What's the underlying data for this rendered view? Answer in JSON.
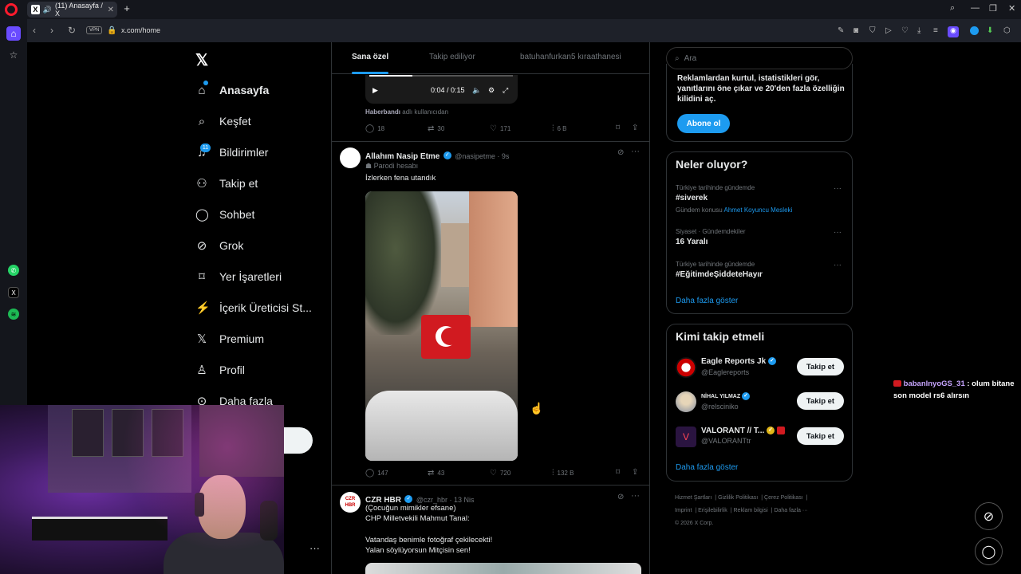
{
  "browser": {
    "tab_title": "(11) Anasayfa / X",
    "url": "x.com/home",
    "vpn_label": "VPN"
  },
  "nav": {
    "items": [
      {
        "label": "Anasayfa",
        "icon": "home-icon"
      },
      {
        "label": "Keşfet",
        "icon": "search-icon"
      },
      {
        "label": "Bildirimler",
        "icon": "bell-icon"
      },
      {
        "label": "Takip et",
        "icon": "add-user-icon"
      },
      {
        "label": "Sohbet",
        "icon": "chat-icon"
      },
      {
        "label": "Grok",
        "icon": "grok-icon"
      },
      {
        "label": "Yer İşaretleri",
        "icon": "bookmark-icon"
      },
      {
        "label": "İçerik Üreticisi St...",
        "icon": "lightning-icon"
      },
      {
        "label": "Premium",
        "icon": "x-logo-icon"
      },
      {
        "label": "Profil",
        "icon": "person-icon"
      },
      {
        "label": "Daha fazla",
        "icon": "more-circle-icon"
      }
    ],
    "notif_count": "11"
  },
  "feed": {
    "tabs": [
      "Sana özel",
      "Takip ediliyor",
      "batuhanfurkan5 kıraathanesi"
    ],
    "video": {
      "time": "0:04 / 0:15",
      "progress": 0.3
    },
    "post0": {
      "source": "Haberbandı",
      "source_suffix": "adlı kullanıcıdan",
      "replies": "18",
      "reposts": "30",
      "likes": "171",
      "views": "6 B"
    },
    "post1": {
      "name": "Allahım Nasip Etme",
      "handle": "@nasipetme · 9s",
      "label": "Parodi hesabı",
      "text": "İzlerken fena utandık",
      "replies": "147",
      "reposts": "43",
      "likes": "720",
      "views": "132 B"
    },
    "post2": {
      "name": "CZR HBR",
      "handle": "@czr_hbr · 13 Nis",
      "avatar_text": "CZR HBR",
      "lines": [
        "(Çocuğun mimikler efsane)",
        "CHP Milletvekili Mahmut Tanal:",
        "",
        "Vatandaş benimle fotoğraf çekilecekti!",
        "Yalan söylüyorsun Mitçisin sen!"
      ]
    }
  },
  "right": {
    "search_placeholder": "Ara",
    "premium_text": "Reklamlardan kurtul, istatistikleri gör, yanıtlarını öne çıkar ve 20'den fazla özelliğin kilidini aç.",
    "subscribe_label": "Abone ol",
    "trends_title": "Neler oluyor?",
    "trends": [
      {
        "category": "Türkiye tarihinde gündemde",
        "name": "#siverek",
        "topic_prefix": "Gündem konusu",
        "topic": "Ahmet Koyuncu Mesleki"
      },
      {
        "category": "Siyaset · Gündemdekiler",
        "name": "16 Yaralı"
      },
      {
        "category": "Türkiye tarihinde gündemde",
        "name": "#EğitimdeŞiddeteHayır"
      }
    ],
    "show_more": "Daha fazla göster",
    "follow_title": "Kimi takip etmeli",
    "follow": [
      {
        "name": "Eagle Reports Jk",
        "handle": "@Eaglereports"
      },
      {
        "name": "NİHAL YILMAZ",
        "handle": "@relsciniko"
      },
      {
        "name": "VALORANT // T...",
        "handle": "@VALORANTtr"
      }
    ],
    "follow_label": "Takip et",
    "footer": [
      "Hizmet Şartları",
      "Gizlilik Politikası",
      "Çerez Politikası",
      "Imprint",
      "Erişilebilirlik",
      "Reklam bilgisi",
      "Daha fazla ···",
      "© 2026 X Corp."
    ]
  },
  "chat": {
    "user": "babanlnyoGS_31",
    "message": ": olum bitane son model rs6 alırsın"
  },
  "colors": {
    "accent": "#1d9bf0",
    "opera": "#ff1b2d",
    "chat_user": "#c7a5ff"
  }
}
